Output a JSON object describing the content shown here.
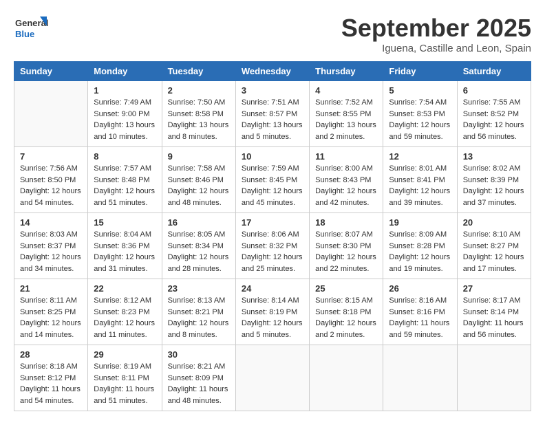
{
  "logo": {
    "line1": "General",
    "line2": "Blue"
  },
  "title": "September 2025",
  "location": "Iguena, Castille and Leon, Spain",
  "days_header": [
    "Sunday",
    "Monday",
    "Tuesday",
    "Wednesday",
    "Thursday",
    "Friday",
    "Saturday"
  ],
  "weeks": [
    [
      {
        "day": "",
        "info": ""
      },
      {
        "day": "1",
        "info": "Sunrise: 7:49 AM\nSunset: 9:00 PM\nDaylight: 13 hours\nand 10 minutes."
      },
      {
        "day": "2",
        "info": "Sunrise: 7:50 AM\nSunset: 8:58 PM\nDaylight: 13 hours\nand 8 minutes."
      },
      {
        "day": "3",
        "info": "Sunrise: 7:51 AM\nSunset: 8:57 PM\nDaylight: 13 hours\nand 5 minutes."
      },
      {
        "day": "4",
        "info": "Sunrise: 7:52 AM\nSunset: 8:55 PM\nDaylight: 13 hours\nand 2 minutes."
      },
      {
        "day": "5",
        "info": "Sunrise: 7:54 AM\nSunset: 8:53 PM\nDaylight: 12 hours\nand 59 minutes."
      },
      {
        "day": "6",
        "info": "Sunrise: 7:55 AM\nSunset: 8:52 PM\nDaylight: 12 hours\nand 56 minutes."
      }
    ],
    [
      {
        "day": "7",
        "info": "Sunrise: 7:56 AM\nSunset: 8:50 PM\nDaylight: 12 hours\nand 54 minutes."
      },
      {
        "day": "8",
        "info": "Sunrise: 7:57 AM\nSunset: 8:48 PM\nDaylight: 12 hours\nand 51 minutes."
      },
      {
        "day": "9",
        "info": "Sunrise: 7:58 AM\nSunset: 8:46 PM\nDaylight: 12 hours\nand 48 minutes."
      },
      {
        "day": "10",
        "info": "Sunrise: 7:59 AM\nSunset: 8:45 PM\nDaylight: 12 hours\nand 45 minutes."
      },
      {
        "day": "11",
        "info": "Sunrise: 8:00 AM\nSunset: 8:43 PM\nDaylight: 12 hours\nand 42 minutes."
      },
      {
        "day": "12",
        "info": "Sunrise: 8:01 AM\nSunset: 8:41 PM\nDaylight: 12 hours\nand 39 minutes."
      },
      {
        "day": "13",
        "info": "Sunrise: 8:02 AM\nSunset: 8:39 PM\nDaylight: 12 hours\nand 37 minutes."
      }
    ],
    [
      {
        "day": "14",
        "info": "Sunrise: 8:03 AM\nSunset: 8:37 PM\nDaylight: 12 hours\nand 34 minutes."
      },
      {
        "day": "15",
        "info": "Sunrise: 8:04 AM\nSunset: 8:36 PM\nDaylight: 12 hours\nand 31 minutes."
      },
      {
        "day": "16",
        "info": "Sunrise: 8:05 AM\nSunset: 8:34 PM\nDaylight: 12 hours\nand 28 minutes."
      },
      {
        "day": "17",
        "info": "Sunrise: 8:06 AM\nSunset: 8:32 PM\nDaylight: 12 hours\nand 25 minutes."
      },
      {
        "day": "18",
        "info": "Sunrise: 8:07 AM\nSunset: 8:30 PM\nDaylight: 12 hours\nand 22 minutes."
      },
      {
        "day": "19",
        "info": "Sunrise: 8:09 AM\nSunset: 8:28 PM\nDaylight: 12 hours\nand 19 minutes."
      },
      {
        "day": "20",
        "info": "Sunrise: 8:10 AM\nSunset: 8:27 PM\nDaylight: 12 hours\nand 17 minutes."
      }
    ],
    [
      {
        "day": "21",
        "info": "Sunrise: 8:11 AM\nSunset: 8:25 PM\nDaylight: 12 hours\nand 14 minutes."
      },
      {
        "day": "22",
        "info": "Sunrise: 8:12 AM\nSunset: 8:23 PM\nDaylight: 12 hours\nand 11 minutes."
      },
      {
        "day": "23",
        "info": "Sunrise: 8:13 AM\nSunset: 8:21 PM\nDaylight: 12 hours\nand 8 minutes."
      },
      {
        "day": "24",
        "info": "Sunrise: 8:14 AM\nSunset: 8:19 PM\nDaylight: 12 hours\nand 5 minutes."
      },
      {
        "day": "25",
        "info": "Sunrise: 8:15 AM\nSunset: 8:18 PM\nDaylight: 12 hours\nand 2 minutes."
      },
      {
        "day": "26",
        "info": "Sunrise: 8:16 AM\nSunset: 8:16 PM\nDaylight: 11 hours\nand 59 minutes."
      },
      {
        "day": "27",
        "info": "Sunrise: 8:17 AM\nSunset: 8:14 PM\nDaylight: 11 hours\nand 56 minutes."
      }
    ],
    [
      {
        "day": "28",
        "info": "Sunrise: 8:18 AM\nSunset: 8:12 PM\nDaylight: 11 hours\nand 54 minutes."
      },
      {
        "day": "29",
        "info": "Sunrise: 8:19 AM\nSunset: 8:11 PM\nDaylight: 11 hours\nand 51 minutes."
      },
      {
        "day": "30",
        "info": "Sunrise: 8:21 AM\nSunset: 8:09 PM\nDaylight: 11 hours\nand 48 minutes."
      },
      {
        "day": "",
        "info": ""
      },
      {
        "day": "",
        "info": ""
      },
      {
        "day": "",
        "info": ""
      },
      {
        "day": "",
        "info": ""
      }
    ]
  ]
}
